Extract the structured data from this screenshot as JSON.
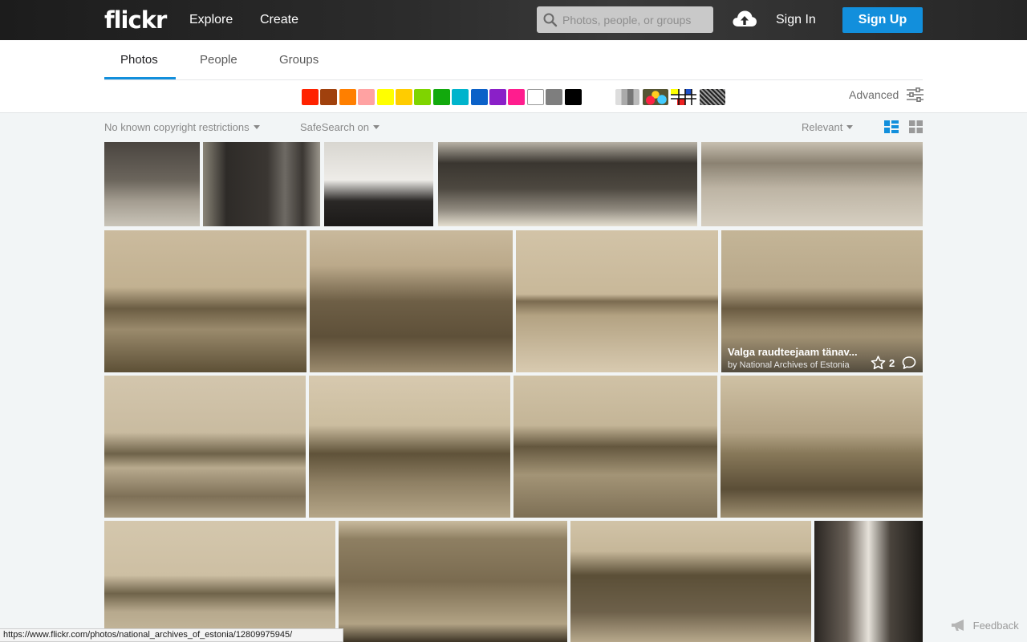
{
  "header": {
    "logo": "flickr",
    "nav": [
      "Explore",
      "Create"
    ],
    "search_placeholder": "Photos, people, or groups",
    "upload_icon": "cloud-upload-icon",
    "signin": "Sign In",
    "signup": "Sign Up",
    "accent_color": "#128fdc"
  },
  "tabs": [
    {
      "label": "Photos",
      "active": true
    },
    {
      "label": "People",
      "active": false
    },
    {
      "label": "Groups",
      "active": false
    }
  ],
  "color_swatches": [
    "#ff2200",
    "#a0410d",
    "#ff7f00",
    "#ffa2a2",
    "#ffff00",
    "#ffcc00",
    "#7fd400",
    "#12a90d",
    "#00b4cc",
    "#0b61c8",
    "#8a20c8",
    "#ff1d8e",
    "#ffffff",
    "#7e7e7e",
    "#000000"
  ],
  "pattern_swatches": [
    "black-and-white",
    "shallow-depth-of-field",
    "minimalist",
    "pattern"
  ],
  "advanced": "Advanced",
  "filters": {
    "license": "No known copyright restrictions",
    "safesearch": "SafeSearch on",
    "sort": "Relevant"
  },
  "overlay": {
    "title": "Valga raudteejaam tänav...",
    "byline": "by National Archives of Estonia",
    "favorites": "2"
  },
  "status_url": "https://www.flickr.com/photos/national_archives_of_estonia/12809975945/",
  "feedback": "Feedback"
}
